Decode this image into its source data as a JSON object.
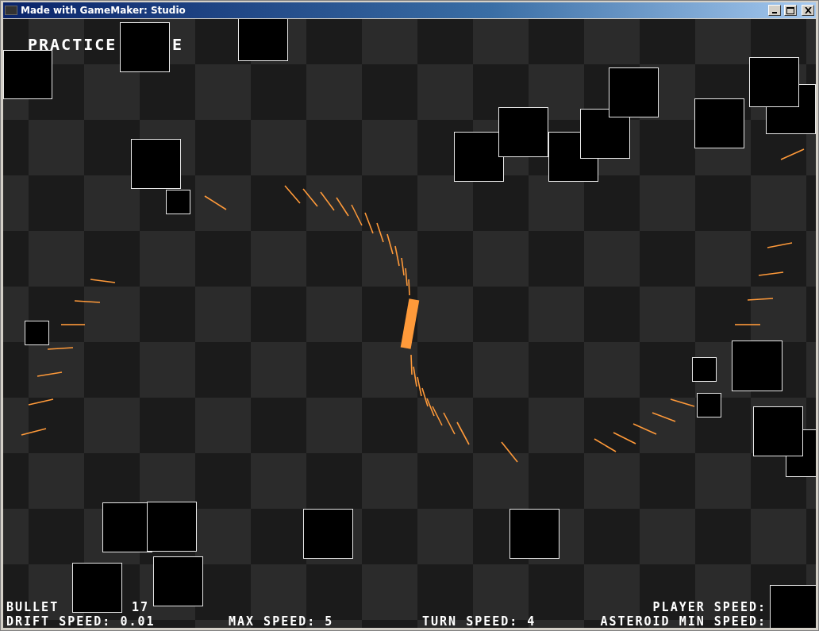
{
  "window": {
    "title": "Made with GameMaker: Studio"
  },
  "mode_title": {
    "left": "PRACTICE",
    "right": "E"
  },
  "hud": [
    {
      "kind": "bullet_label",
      "text": "BULLET"
    },
    {
      "kind": "bullet_value",
      "text": "17"
    },
    {
      "kind": "player_speed",
      "text": "PLAYER SPEED:"
    },
    {
      "kind": "drift_speed",
      "text": "DRIFT SPEED: 0.01"
    },
    {
      "kind": "max_speed",
      "text": "MAX SPEED: 5"
    },
    {
      "kind": "turn_speed",
      "text": "TURN SPEED: 4"
    },
    {
      "kind": "asteroid_min_speed",
      "text": "ASTEROID MIN SPEED:"
    }
  ]
}
